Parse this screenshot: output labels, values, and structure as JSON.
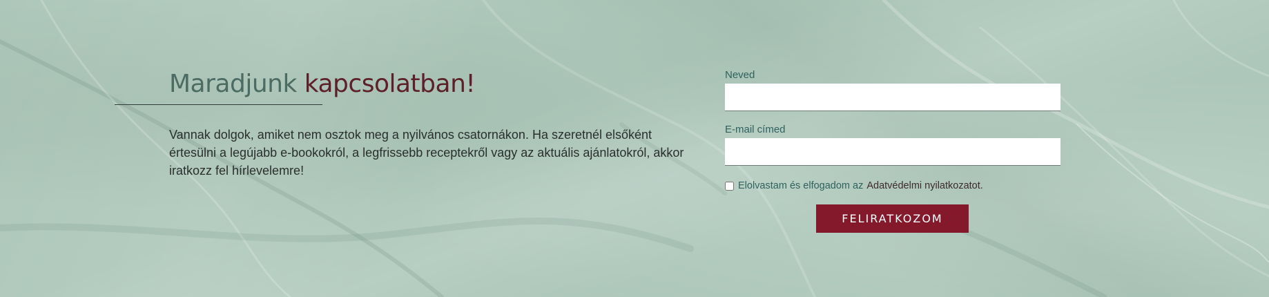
{
  "newsletter": {
    "heading_part1": "Maradjunk",
    "heading_part2": "kapcsolatban!",
    "intro_text": "Vannak dolgok, amiket nem osztok meg a nyilvános csatornákon. Ha szeretnél elsőként értesülni a legújabb e-bookokról, a legfrissebb receptekről vagy az aktuális ajánlatokról, akkor iratkozz fel hírlevelemre!"
  },
  "form": {
    "name_label": "Neved",
    "name_value": "",
    "email_label": "E-mail címed",
    "email_value": "",
    "consent_text": "Elolvastam és elfogadom az",
    "consent_link": "Adatvédelmi nyilatkozatot",
    "consent_period": ".",
    "consent_checked": false,
    "submit_label": "FELIRATKOZOM"
  },
  "colors": {
    "background": "#adc7ba",
    "heading_primary": "#4b6b63",
    "heading_accent": "#5d2028",
    "label": "#2f615d",
    "button": "#85192c",
    "button_text": "#ffffff"
  }
}
